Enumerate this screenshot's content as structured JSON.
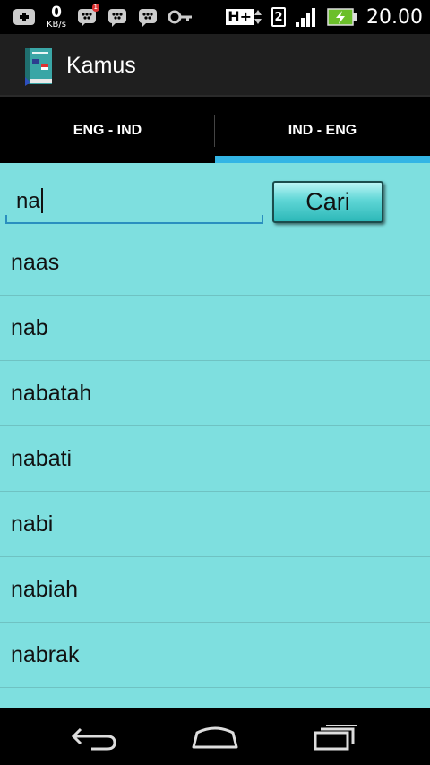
{
  "status_bar": {
    "net_speed_value": "0",
    "net_speed_unit": "KB/s",
    "bbm_badge": "1",
    "network_type": "H+",
    "sim_slot": "2",
    "clock": "20.00"
  },
  "app_bar": {
    "title": "Kamus",
    "icon": "dictionary-book-icon"
  },
  "tabs": [
    {
      "label": "ENG - IND",
      "selected": false
    },
    {
      "label": "IND - ENG",
      "selected": true
    }
  ],
  "search": {
    "value": "na",
    "button_label": "Cari"
  },
  "results": [
    {
      "word": "naas"
    },
    {
      "word": "nab"
    },
    {
      "word": "nabatah"
    },
    {
      "word": "nabati"
    },
    {
      "word": "nabi"
    },
    {
      "word": "nabiah"
    },
    {
      "word": "nabrak"
    }
  ],
  "nav_bar": {
    "icons": [
      "back-icon",
      "home-icon",
      "recent-apps-icon"
    ]
  },
  "colors": {
    "content_bg": "#7edfdf",
    "tab_indicator": "#33b5e5",
    "button_teal": "#5fd6d6"
  }
}
